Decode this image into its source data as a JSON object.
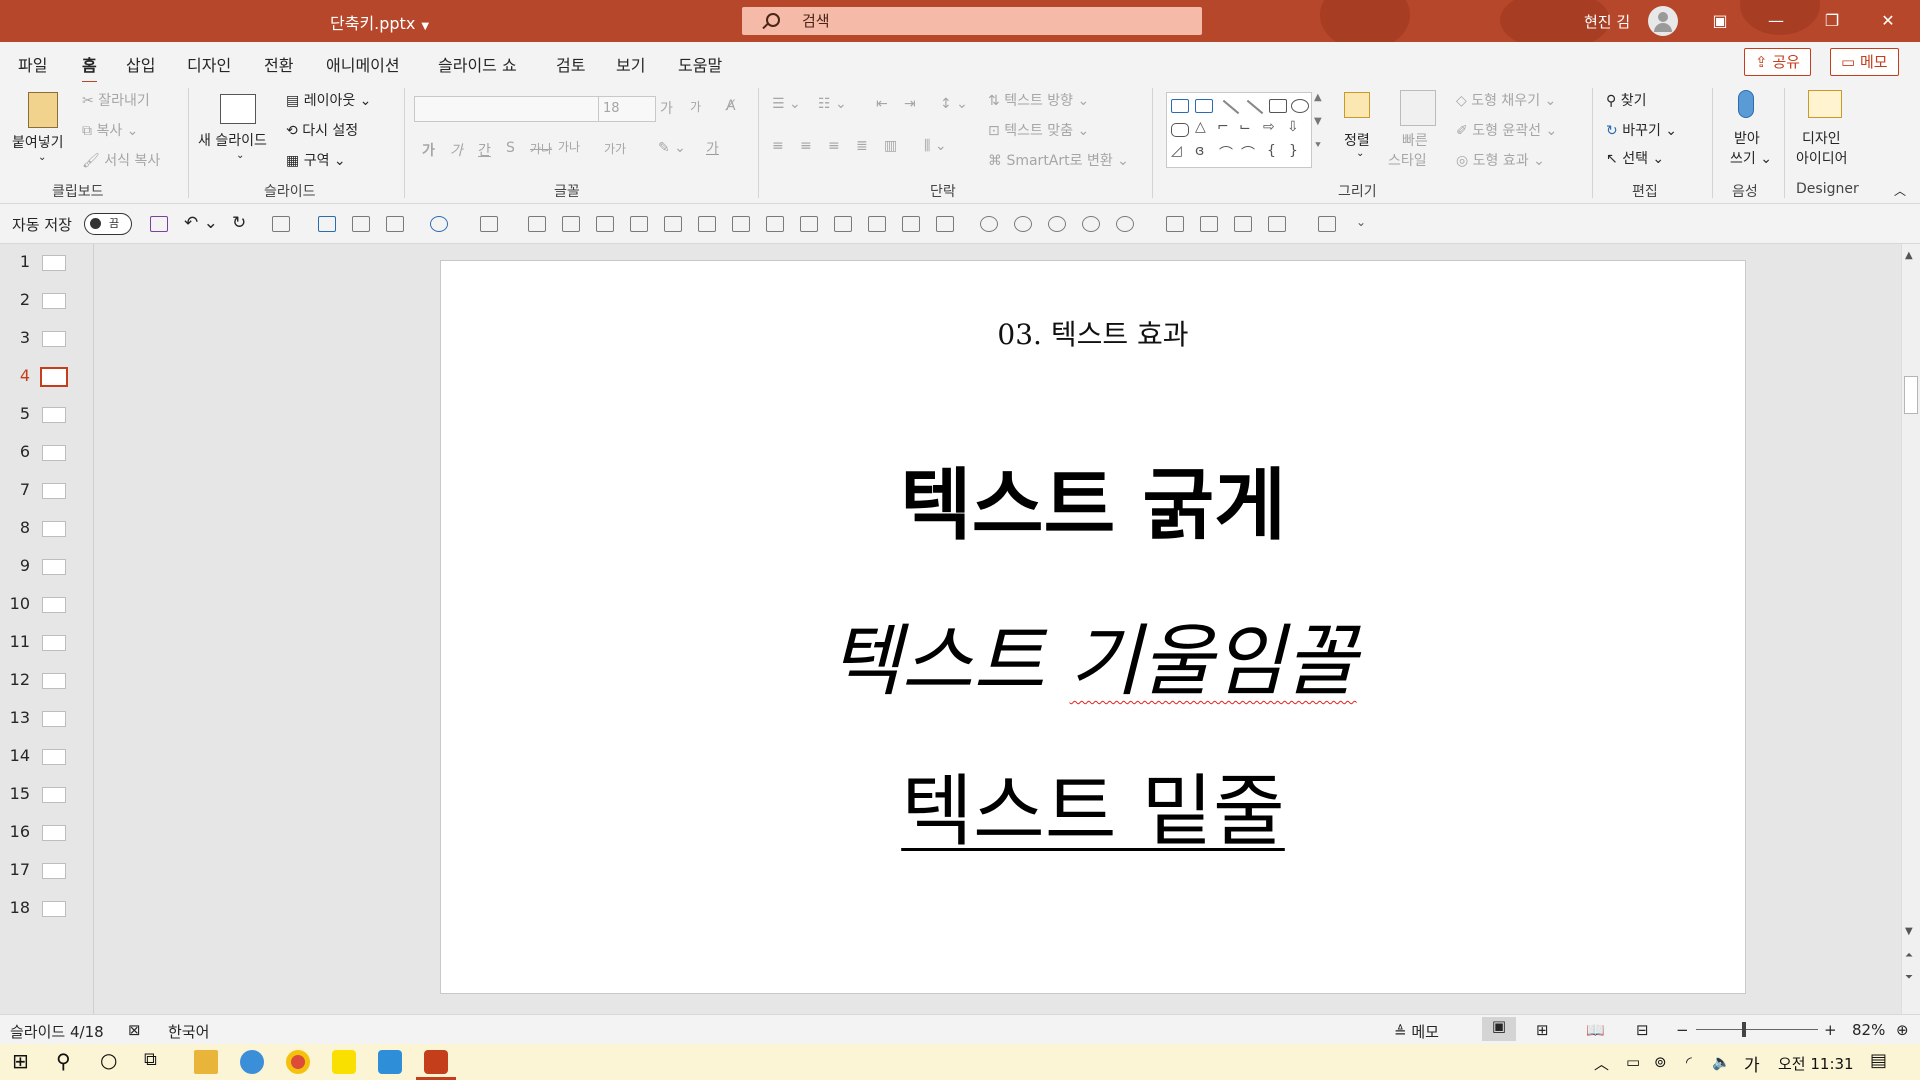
{
  "window": {
    "doc_title": "단축키.pptx",
    "search_placeholder": "검색",
    "user_name": "현진 김"
  },
  "tabs": [
    "파일",
    "홈",
    "삽입",
    "디자인",
    "전환",
    "애니메이션",
    "슬라이드 쇼",
    "검토",
    "보기",
    "도움말"
  ],
  "active_tab": "홈",
  "share_label": "공유",
  "memo_label": "메모",
  "ribbon": {
    "clipboard": {
      "paste": "붙여넣기",
      "cut": "잘라내기",
      "copy": "복사",
      "format_painter": "서식 복사",
      "label": "클립보드"
    },
    "slides": {
      "new_slide": "새 슬라이드",
      "layout": "레이아웃",
      "reset": "다시 설정",
      "section": "구역",
      "label": "슬라이드"
    },
    "font": {
      "size": "18",
      "label": "글꼴",
      "grow": "가",
      "shrink": "가",
      "bold": "가",
      "italic": "가",
      "underline": "간",
      "shadow": "S",
      "strike": "가나",
      "spacing": "가나",
      "case": "가가",
      "font_color": "가"
    },
    "paragraph": {
      "text_direction": "텍스트 방향",
      "align_text": "텍스트 맞춤",
      "smartart": "SmartArt로 변환",
      "label": "단락"
    },
    "drawing": {
      "arrange": "정렬",
      "quick_styles_1": "빠른",
      "quick_styles_2": "스타일",
      "fill": "도형 채우기",
      "outline": "도형 윤곽선",
      "effects": "도형 효과",
      "label": "그리기"
    },
    "editing": {
      "find": "찾기",
      "replace": "바꾸기",
      "select": "선택",
      "label": "편집"
    },
    "voice": {
      "dictate_1": "받아",
      "dictate_2": "쓰기",
      "label": "음성"
    },
    "designer": {
      "ideas_1": "디자인",
      "ideas_2": "아이디어",
      "label": "Designer"
    }
  },
  "qat": {
    "autosave": "자동 저장",
    "toggle": "끔"
  },
  "slides": [
    "1",
    "2",
    "3",
    "4",
    "5",
    "6",
    "7",
    "8",
    "9",
    "10",
    "11",
    "12",
    "13",
    "14",
    "15",
    "16",
    "17",
    "18"
  ],
  "active_slide": 4,
  "slide": {
    "heading": "03. 텍스트 효과",
    "line_bold": "텍스트 굵게",
    "line_italic_a": "텍스트 ",
    "line_italic_b": "기울임꼴",
    "line_under": "텍스트 밑줄"
  },
  "status": {
    "slide_count": "슬라이드 4/18",
    "language": "한국어",
    "notes": "메모",
    "zoom": "82%"
  },
  "taskbar": {
    "ime": "가",
    "clock": "오전 11:31"
  },
  "colors": {
    "accent": "#b7472a",
    "active_red": "#c43e1c"
  }
}
